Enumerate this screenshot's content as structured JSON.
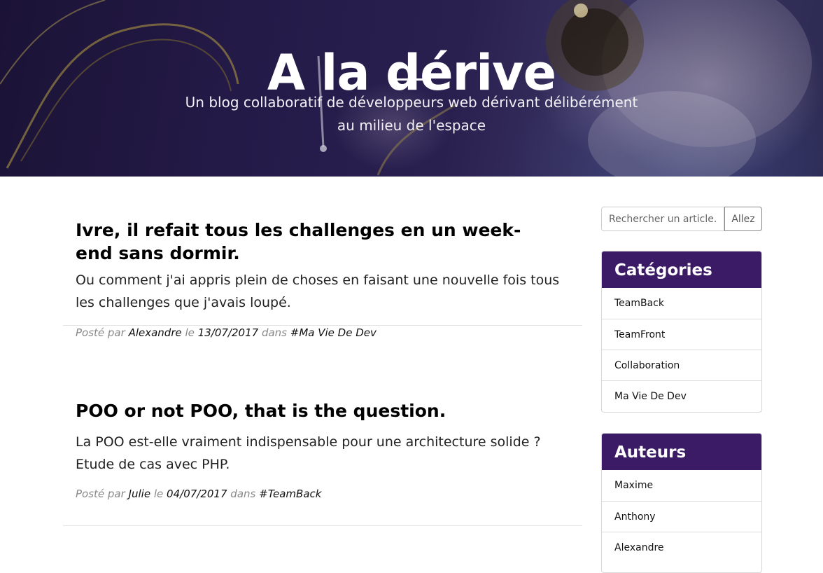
{
  "hero": {
    "title": "A la dérive",
    "subtitle": "Un blog collaboratif de développeurs web dérivant délibérément au milieu de l'espace"
  },
  "posts": [
    {
      "title": "Ivre, il refait tous les challenges en un week-end sans dormir.",
      "excerpt": "Ou comment j'ai appris plein de choses en faisant une nouvelle fois tous les challenges que j'avais loupé.",
      "meta_posted_by": "Posté par",
      "author": "Alexandre",
      "meta_on": "le",
      "date": "13/07/2017",
      "meta_in": "dans",
      "category": "#Ma Vie De Dev"
    },
    {
      "title": "POO or not POO, that is the question.",
      "excerpt": "La POO est-elle vraiment indispensable pour une architecture solide ? Etude de cas avec PHP.",
      "meta_posted_by": "Posté par",
      "author": "Julie",
      "meta_on": "le",
      "date": "04/07/2017",
      "meta_in": "dans",
      "category": "#TeamBack"
    }
  ],
  "search": {
    "placeholder": "Rechercher un article...",
    "button_label": "Allez"
  },
  "categories": {
    "heading": "Catégories",
    "items": [
      "TeamBack",
      "TeamFront",
      "Collaboration",
      "Ma Vie De Dev"
    ]
  },
  "authors": {
    "heading": "Auteurs",
    "items": [
      "Maxime",
      "Anthony",
      "Alexandre"
    ]
  },
  "colors": {
    "panel_header": "#3b1a66",
    "hero_background": "#241a48"
  }
}
